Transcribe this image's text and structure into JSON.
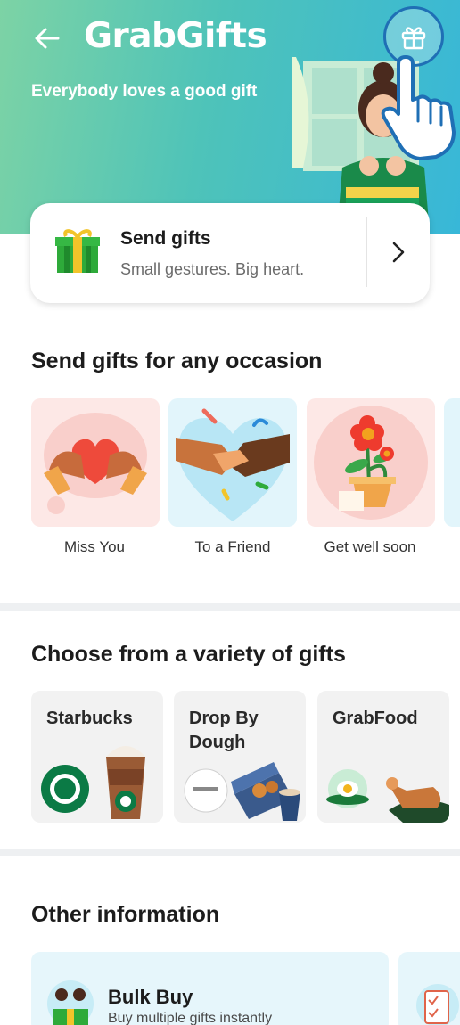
{
  "header": {
    "logo_bold": "Grab",
    "logo_light": "Gifts",
    "tagline": "Everybody loves a good gift"
  },
  "icons": {
    "back": "arrow-left-icon",
    "gift_button": "gift-icon",
    "chevron": "chevron-right-icon"
  },
  "send_gifts": {
    "title": "Send gifts",
    "subtitle": "Small gestures. Big heart."
  },
  "occasions": {
    "title": "Send gifts for any occasion",
    "items": [
      {
        "label": "Miss You"
      },
      {
        "label": "To a Friend"
      },
      {
        "label": "Get well soon"
      }
    ]
  },
  "gifts": {
    "title": "Choose from a variety of gifts",
    "brands": [
      {
        "name": "Starbucks"
      },
      {
        "name": "Drop By Dough"
      },
      {
        "name": "GrabFood"
      }
    ]
  },
  "other": {
    "title": "Other information",
    "items": [
      {
        "title": "Bulk Buy",
        "subtitle": "Buy multiple gifts instantly"
      }
    ]
  },
  "colors": {
    "header_start": "#7dd3a5",
    "header_end": "#38b7d8",
    "brand_green": "#00b14f",
    "highlight_ring": "#1f6fb5"
  }
}
